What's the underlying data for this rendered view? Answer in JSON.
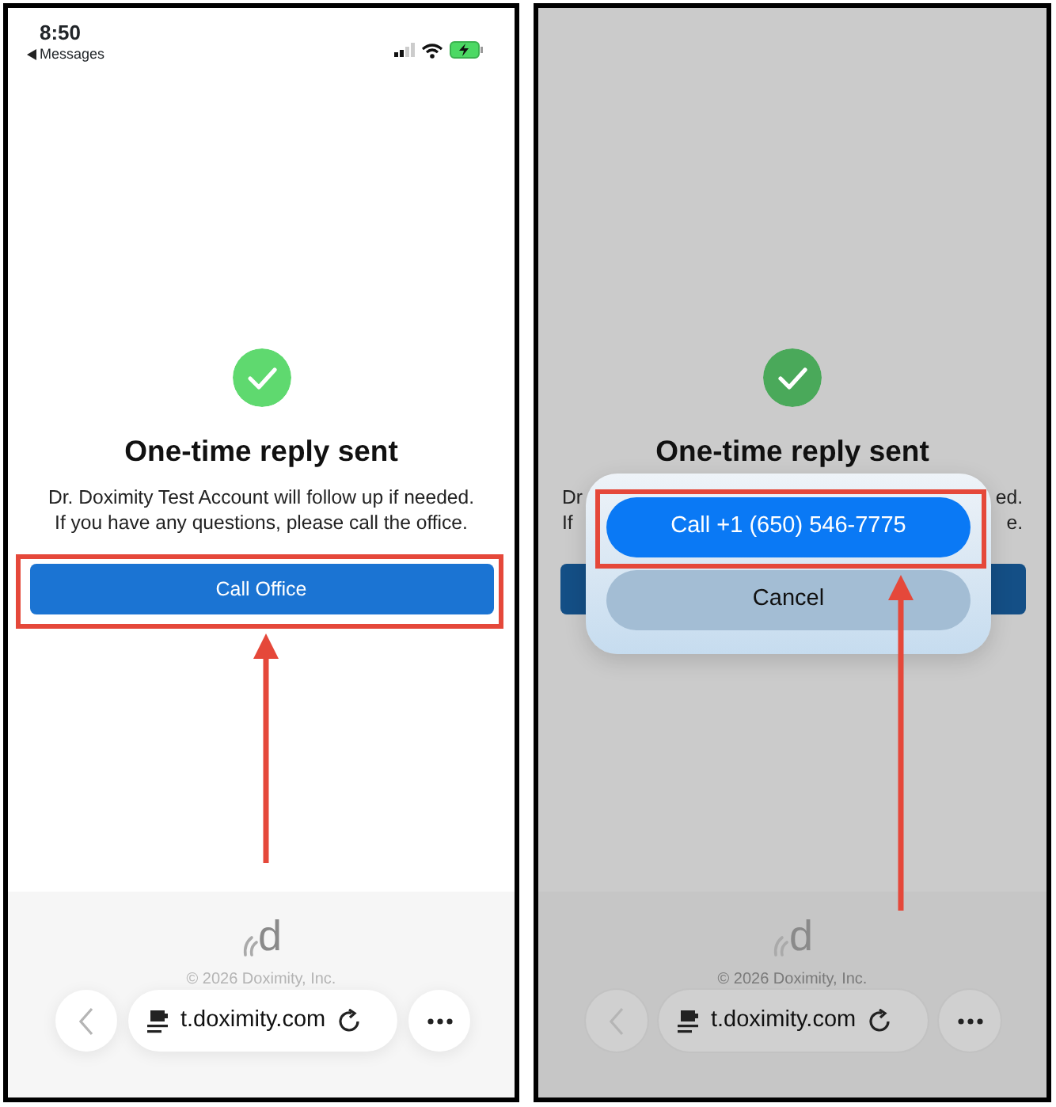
{
  "panels": [
    {
      "kind": "page",
      "status_bar": {
        "time": "8:50",
        "back_label": "Messages",
        "charging": true
      },
      "title": "One-time reply sent",
      "message_lines": [
        {
          "text": "Dr. Doximity Test Account will follow up if needed."
        },
        {
          "text": "If you have any questions, please call the office."
        }
      ],
      "button": {
        "label": "Call Office",
        "highlighted": true
      },
      "footer": {
        "logo_letter": "d",
        "copyright": "© 2026 Doximity, Inc."
      },
      "browser_bar": {
        "url": "t.doximity.com"
      }
    },
    {
      "kind": "dialog",
      "title": "One-time reply sent",
      "message_lines": [
        {
          "left": "Dr",
          "right": "ed."
        },
        {
          "left": "If",
          "right": "e."
        }
      ],
      "sheet": {
        "actions": [
          {
            "label": "Call +1 (650) 546-7775",
            "kind": "primary",
            "highlighted": true
          },
          {
            "label": "Cancel",
            "kind": "cancel",
            "highlighted": false
          }
        ]
      },
      "footer": {
        "logo_letter": "d",
        "copyright": "© 2026 Doximity, Inc."
      },
      "browser_bar": {
        "url": "t.doximity.com"
      }
    }
  ]
}
